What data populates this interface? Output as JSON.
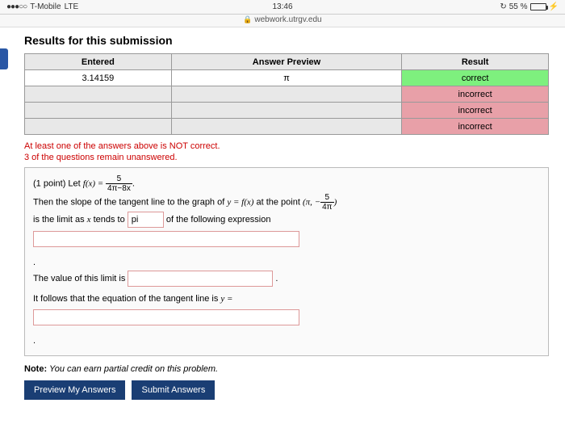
{
  "status": {
    "carrier": "T-Mobile",
    "net": "LTE",
    "time": "13:46",
    "battery": "55 %",
    "signal": "●●●○○"
  },
  "url": {
    "domain": "webwork.utrgv.edu"
  },
  "heading": "Results for this submission",
  "table": {
    "headers": [
      "Entered",
      "Answer Preview",
      "Result"
    ],
    "rows": [
      {
        "entered": "3.14159",
        "preview": "π",
        "result": "correct",
        "status": "correct"
      },
      {
        "entered": "",
        "preview": "",
        "result": "incorrect",
        "status": "incorrect"
      },
      {
        "entered": "",
        "preview": "",
        "result": "incorrect",
        "status": "incorrect"
      },
      {
        "entered": "",
        "preview": "",
        "result": "incorrect",
        "status": "incorrect"
      }
    ]
  },
  "msg1": "At least one of the answers above is NOT correct.",
  "msg2": "3 of the questions remain unanswered.",
  "problem": {
    "points": "(1 point) Let ",
    "line2a": "Then the slope of the tangent line to the graph of ",
    "line2b": " at the point ",
    "line3a": "is the limit as ",
    "line3b": " tends to ",
    "line3c": " of the following expression",
    "input1_value": "pi",
    "line4": "The value of this limit is ",
    "line5": "It follows that the equation of the tangent line is "
  },
  "note_label": "Note:",
  "note_text": " You can earn partial credit on this problem.",
  "buttons": {
    "preview": "Preview My Answers",
    "submit": "Submit Answers"
  }
}
